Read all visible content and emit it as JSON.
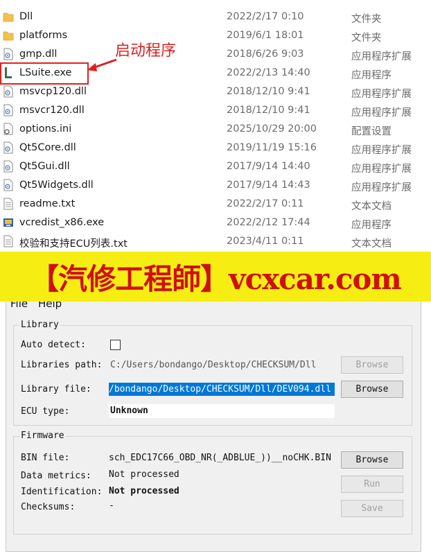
{
  "files": [
    {
      "name": "Dll",
      "date": "2022/2/17 0:10",
      "type": "文件夹",
      "icon": "folder-icon"
    },
    {
      "name": "platforms",
      "date": "2019/6/1 18:01",
      "type": "文件夹",
      "icon": "folder-icon"
    },
    {
      "name": "gmp.dll",
      "date": "2018/6/26 9:03",
      "type": "应用程序扩展",
      "icon": "dll-icon"
    },
    {
      "name": "LSuite.exe",
      "date": "2022/2/13 14:40",
      "type": "应用程序",
      "icon": "lsuite-app-icon"
    },
    {
      "name": "msvcp120.dll",
      "date": "2018/12/10 9:41",
      "type": "应用程序扩展",
      "icon": "dll-icon"
    },
    {
      "name": "msvcr120.dll",
      "date": "2018/12/10 9:41",
      "type": "应用程序扩展",
      "icon": "dll-icon"
    },
    {
      "name": "options.ini",
      "date": "2025/10/29 20:00",
      "type": "配置设置",
      "icon": "ini-icon"
    },
    {
      "name": "Qt5Core.dll",
      "date": "2019/11/19 15:16",
      "type": "应用程序扩展",
      "icon": "dll-icon"
    },
    {
      "name": "Qt5Gui.dll",
      "date": "2017/9/14 14:40",
      "type": "应用程序扩展",
      "icon": "dll-icon"
    },
    {
      "name": "Qt5Widgets.dll",
      "date": "2017/9/14 14:43",
      "type": "应用程序扩展",
      "icon": "dll-icon"
    },
    {
      "name": "readme.txt",
      "date": "2022/2/17 0:11",
      "type": "文本文档",
      "icon": "text-file-icon"
    },
    {
      "name": "vcredist_x86.exe",
      "date": "2022/2/12 17:44",
      "type": "应用程序",
      "icon": "installer-icon"
    },
    {
      "name": "校验和支持ECU列表.txt",
      "date": "2023/4/11 0:11",
      "type": "文本文档",
      "icon": "text-file-icon"
    }
  ],
  "annotation": {
    "label": "启动程序",
    "color": "#e01e1e"
  },
  "banner": {
    "text": "【汽修工程師】vcxcar.com",
    "bg": "#f6ee12",
    "color": "#d01010"
  },
  "app": {
    "menu": {
      "file": "File",
      "help": "Help"
    },
    "library": {
      "title": "Library",
      "auto_detect_label": "Auto detect:",
      "libraries_path_label": "Libraries path:",
      "libraries_path_value": "C:/Users/bondango/Desktop/CHECKSUM/Dll",
      "library_file_label": "Library file:",
      "library_file_value": "/bondango/Desktop/CHECKSUM/Dll/DEV094.dll",
      "ecu_type_label": "ECU type:",
      "ecu_type_value": "Unknown",
      "browse_path": "Browse",
      "browse_file": "Browse"
    },
    "firmware": {
      "title": "Firmware",
      "bin_file_label": "BIN file:",
      "bin_file_value": "sch_EDC17C66_OBD_NR(_ADBLUE_))__noCHK.BIN",
      "data_metrics_label": "Data metrics:",
      "data_metrics_value": "Not processed",
      "identification_label": "Identification:",
      "identification_value": "Not processed",
      "checksums_label": "Checksums:",
      "checksums_value": "-",
      "browse": "Browse",
      "run": "Run",
      "save": "Save"
    },
    "selection_color": "#0078d7"
  }
}
